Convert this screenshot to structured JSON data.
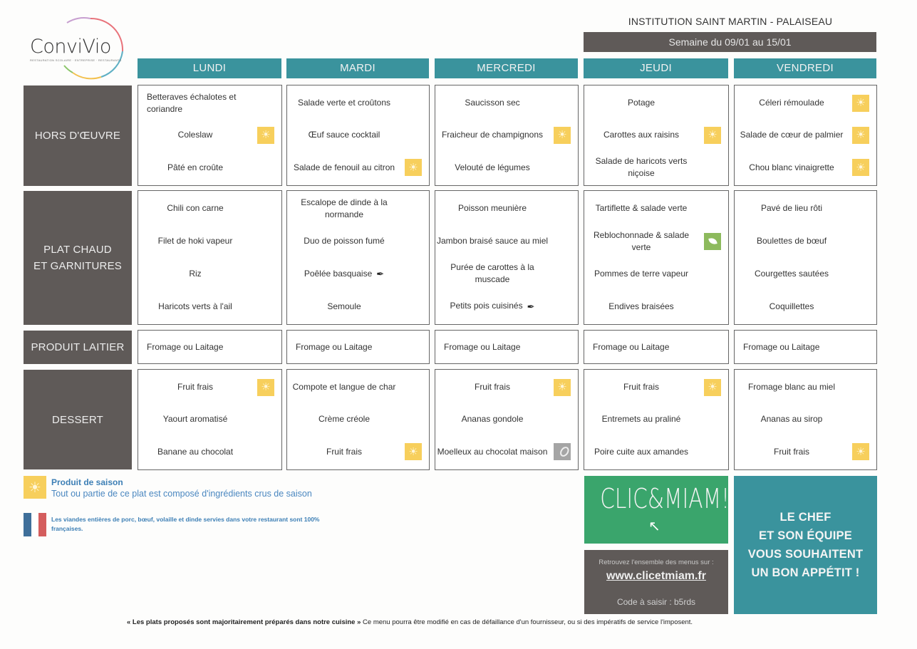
{
  "brand": {
    "logo_text": "ConviVio",
    "logo_subtitle": "RESTAURATION SCOLAIRE · ENTREPRISE · RESTAURANTS"
  },
  "header": {
    "institution": "INSTITUTION SAINT MARTIN - PALAISEAU",
    "week": "Semaine du 09/01 au 15/01"
  },
  "days": [
    "LUNDI",
    "MARDI",
    "MERCREDI",
    "JEUDI",
    "VENDREDI"
  ],
  "rows": {
    "hors_doeuvre": {
      "label": "HORS D'ŒUVRE",
      "cells": [
        [
          {
            "name": "Betteraves échalotes et coriandre",
            "align": "left"
          },
          {
            "name": "Coleslaw",
            "icon": "sun-icon"
          },
          {
            "name": "Pâté en croûte"
          }
        ],
        [
          {
            "name": "Salade verte et croûtons"
          },
          {
            "name": "Œuf sauce cocktail"
          },
          {
            "name": "Salade de fenouil au citron",
            "icon": "sun-icon"
          }
        ],
        [
          {
            "name": "Saucisson sec"
          },
          {
            "name": "Fraicheur de champignons",
            "icon": "sun-icon"
          },
          {
            "name": "Velouté de légumes"
          }
        ],
        [
          {
            "name": "Potage"
          },
          {
            "name": "Carottes aux raisins",
            "icon": "sun-icon"
          },
          {
            "name": "Salade de haricots verts niçoise"
          }
        ],
        [
          {
            "name": "Céleri rémoulade",
            "icon": "sun-icon"
          },
          {
            "name": "Salade de cœur de palmier",
            "icon": "sun-icon"
          },
          {
            "name": "Chou blanc vinaigrette",
            "icon": "sun-icon"
          }
        ]
      ]
    },
    "plat_chaud": {
      "label_line1": "PLAT CHAUD",
      "label_line2": "ET GARNITURES",
      "cells": [
        [
          {
            "name": "Chili con carne"
          },
          {
            "name": "Filet de hoki vapeur"
          },
          {
            "name": "Riz"
          },
          {
            "name": "Haricots verts à l'ail"
          }
        ],
        [
          {
            "name": "Escalope de dinde à la normande"
          },
          {
            "name": "Duo de poisson fumé"
          },
          {
            "name": "Poêlée basquaise",
            "inline_icon": "pen-icon"
          },
          {
            "name": "Semoule"
          }
        ],
        [
          {
            "name": "Poisson meunière"
          },
          {
            "name": "Jambon braisé sauce au miel"
          },
          {
            "name": "Purée de carottes à la muscade"
          },
          {
            "name": "Petits pois cuisinés",
            "inline_icon": "pen-icon"
          }
        ],
        [
          {
            "name": "Tartiflette & salade verte"
          },
          {
            "name": "Reblochonnade & salade verte",
            "icon": "leaf-icon"
          },
          {
            "name": "Pommes de terre vapeur"
          },
          {
            "name": "Endives braisées"
          }
        ],
        [
          {
            "name": "Pavé de lieu rôti"
          },
          {
            "name": "Boulettes de bœuf"
          },
          {
            "name": "Courgettes sautées"
          },
          {
            "name": "Coquillettes"
          }
        ]
      ]
    },
    "produit_laitier": {
      "label": "PRODUIT LAITIER",
      "cells": [
        "Fromage ou Laitage",
        "Fromage ou Laitage",
        "Fromage ou Laitage",
        "Fromage ou Laitage",
        "Fromage ou Laitage"
      ]
    },
    "dessert": {
      "label": "DESSERT",
      "cells": [
        [
          {
            "name": "Fruit frais",
            "icon": "sun-icon"
          },
          {
            "name": "Yaourt aromatisé"
          },
          {
            "name": "Banane au chocolat"
          }
        ],
        [
          {
            "name": "Compote et langue de char"
          },
          {
            "name": "Crème créole"
          },
          {
            "name": "Fruit frais",
            "icon": "sun-icon"
          }
        ],
        [
          {
            "name": "Fruit frais",
            "icon": "sun-icon"
          },
          {
            "name": "Ananas gondole"
          },
          {
            "name": "Moelleux au chocolat maison",
            "icon": "whisk-icon"
          }
        ],
        [
          {
            "name": "Fruit frais",
            "icon": "sun-icon"
          },
          {
            "name": "Entremets au praliné"
          },
          {
            "name": "Poire cuite aux amandes"
          }
        ],
        [
          {
            "name": "Fromage blanc au miel"
          },
          {
            "name": "Ananas au sirop"
          },
          {
            "name": "Fruit frais",
            "icon": "sun-icon"
          }
        ]
      ]
    }
  },
  "legend": {
    "season_title": "Produit de saison",
    "season_desc": "Tout ou partie de ce plat est composé d'ingrédients crus de saison",
    "meat_origin": "Les viandes entières de porc, bœuf, volaille et dinde servies dans votre restaurant sont 100% françaises."
  },
  "clicmiam": {
    "logo": "CLIC&MIAM!",
    "info_line": "Retrouvez l'ensemble des menus sur :",
    "url": "www.clicetmiam.fr",
    "code": "Code à saisir : b5rds"
  },
  "chef_message": [
    "LE CHEF",
    "ET SON ÉQUIPE",
    "VOUS SOUHAITENT",
    "UN BON APPÉTIT !"
  ],
  "footer": {
    "bold": "« Les plats proposés sont majoritairement préparés dans notre cuisine »",
    "rest": " Ce menu pourra être modifié en cas de défaillance d'un fournisseur, ou si des impératifs de service l'imposent."
  },
  "colors": {
    "teal": "#3a939d",
    "dark_gray": "#5f5a58",
    "season_yellow": "#f7cf5c",
    "clic_green": "#3aa56c",
    "legend_blue": "#3d7fb5"
  }
}
